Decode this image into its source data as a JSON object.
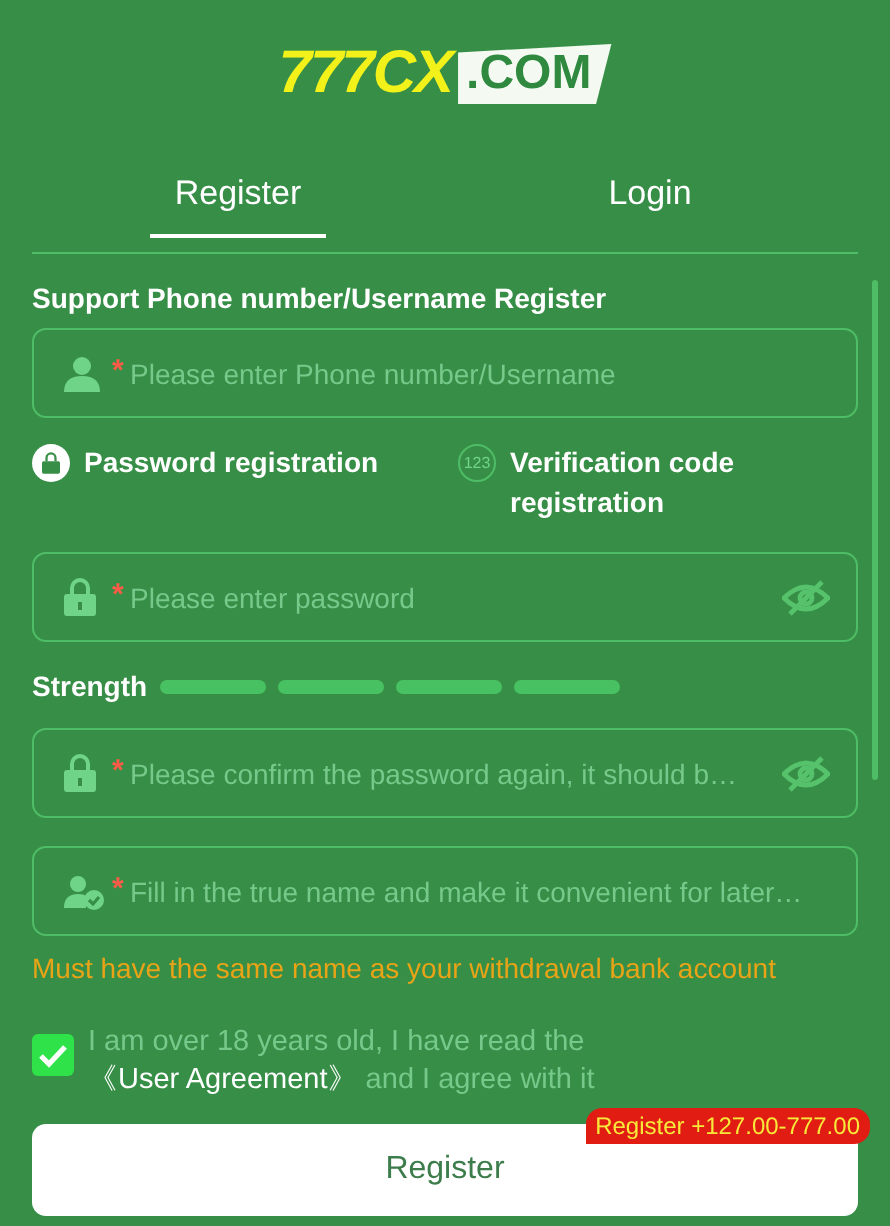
{
  "logo": {
    "part_1": "777CX",
    "part_2": ".COM"
  },
  "tabs": [
    {
      "label": "Register",
      "selected": true
    },
    {
      "label": "Login",
      "selected": false
    }
  ],
  "heading": "Support Phone number/Username Register",
  "account_field": {
    "kind": "user",
    "required_mark": "*",
    "placeholder": "Please enter Phone number/Username"
  },
  "modes": [
    {
      "kind": "lock",
      "label": "Password registration",
      "selected": true
    },
    {
      "kind": "code",
      "icon_text": "123",
      "label": "Verification code registration",
      "selected": false
    }
  ],
  "password_field": {
    "kind": "lock",
    "required_mark": "*",
    "placeholder": "Please enter password",
    "password_visible": false
  },
  "strength": {
    "label": "Strength"
  },
  "confirm_field": {
    "kind": "lock",
    "required_mark": "*",
    "placeholder": "Please confirm the password again, it should b…",
    "password_visible": false
  },
  "name_field": {
    "kind": "user-check",
    "required_mark": "*",
    "placeholder": "Fill in the true name and make it convenient for later…"
  },
  "name_note": "Must have the same name as your withdrawal bank account",
  "agreement": {
    "checked": true,
    "text_before": "I am over 18 years old, I have read the ",
    "link": "《User Agreement》",
    "text_after": " and I agree with it"
  },
  "register_button": {
    "label": "Register",
    "badge": "Register +127.00-777.00"
  }
}
